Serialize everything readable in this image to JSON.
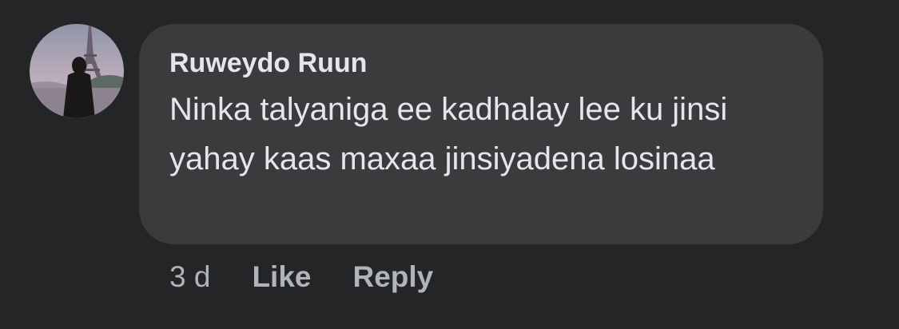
{
  "comment": {
    "author": "Ruweydo Ruun",
    "text": "Ninka talyaniga ee kadhalay lee ku jinsi yahay kaas maxaa jinsiyadena losinaa",
    "timestamp": "3 d",
    "like_label": "Like",
    "reply_label": "Reply"
  },
  "colors": {
    "background": "#242526",
    "bubble": "#3a3b3c",
    "primary_text": "#e4e6eb",
    "secondary_text": "#b0b3b8"
  }
}
